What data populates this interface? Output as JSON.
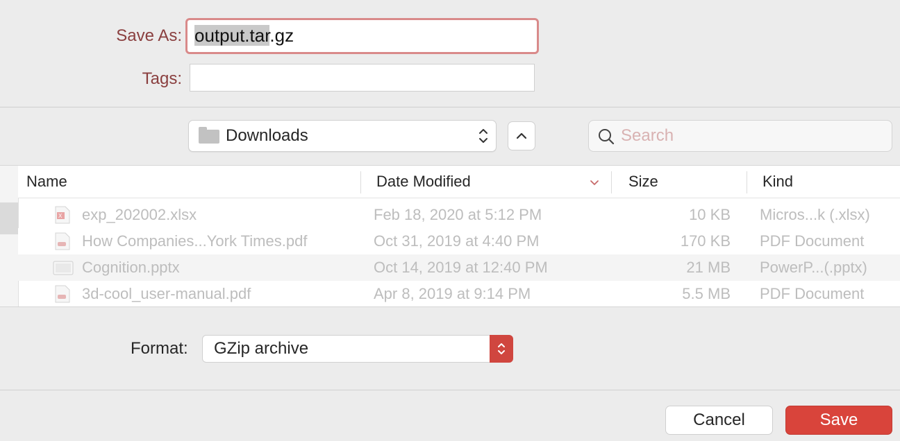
{
  "dialog": {
    "save_as_label": "Save As:",
    "filename_selected": "output.tar",
    "filename_rest": ".gz",
    "tags_label": "Tags:",
    "tags_value": ""
  },
  "location": {
    "folder": "Downloads",
    "search_placeholder": "Search"
  },
  "table": {
    "columns": [
      "Name",
      "Date Modified",
      "Size",
      "Kind"
    ],
    "sort_column": "Date Modified",
    "rows": [
      {
        "name": "exp_202002.xlsx",
        "date": "Feb 18, 2020 at 5:12 PM",
        "size": "10 KB",
        "kind": "Micros...k (.xlsx)",
        "icon": "excel-file-icon"
      },
      {
        "name": "How Companies...York Times.pdf",
        "date": "Oct 31, 2019 at 4:40 PM",
        "size": "170 KB",
        "kind": "PDF Document",
        "icon": "pdf-file-icon"
      },
      {
        "name": "Cognition.pptx",
        "date": "Oct 14, 2019 at 12:40 PM",
        "size": "21 MB",
        "kind": "PowerP...(.pptx)",
        "icon": "powerpoint-file-icon"
      },
      {
        "name": "3d-cool_user-manual.pdf",
        "date": "Apr 8, 2019 at 9:14 PM",
        "size": "5.5 MB",
        "kind": "PDF Document",
        "icon": "pdf-file-icon"
      }
    ]
  },
  "format": {
    "label": "Format:",
    "value": "GZip archive"
  },
  "buttons": {
    "cancel": "Cancel",
    "save": "Save"
  },
  "colors": {
    "accent": "#d9443b",
    "label_red": "#8a3f3f",
    "focus_ring": "#d98a8a"
  }
}
